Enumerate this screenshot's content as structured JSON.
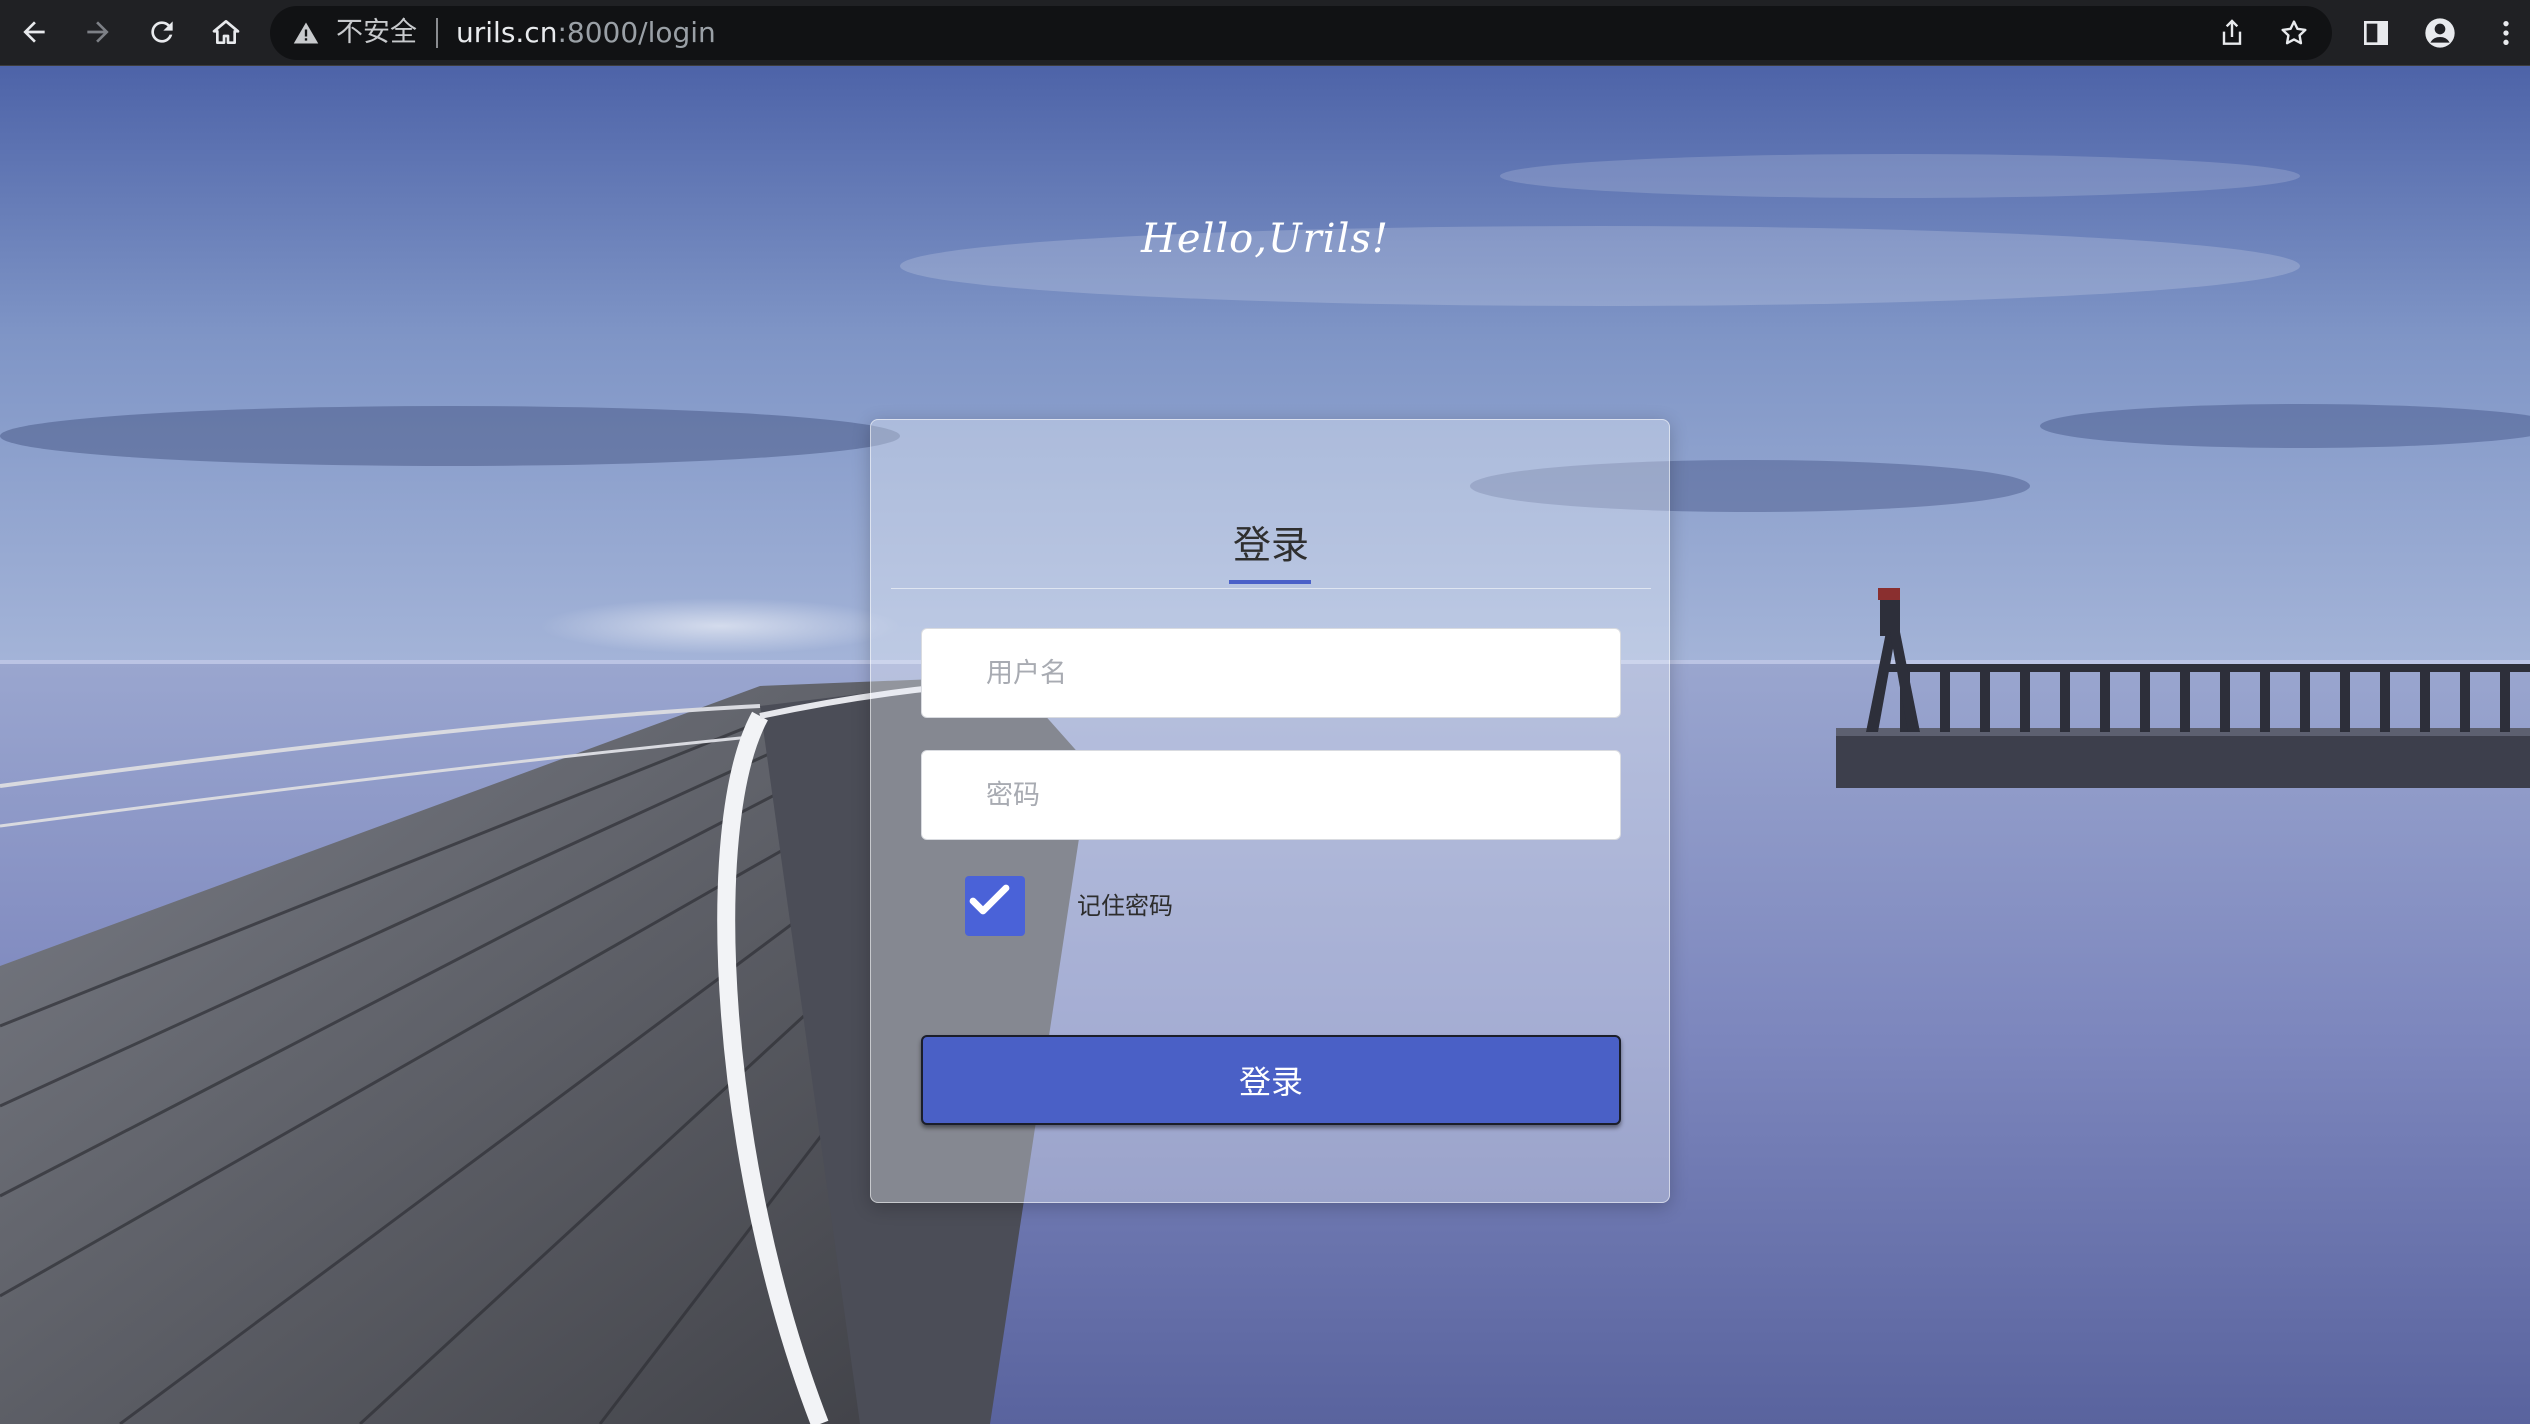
{
  "browser": {
    "security_label": "不安全",
    "url_host": "urils.cn",
    "url_path": ":8000/login"
  },
  "page": {
    "greeting": "Hello,Urils!"
  },
  "login": {
    "title": "登录",
    "username_placeholder": "用户名",
    "password_placeholder": "密码",
    "remember_label": "记住密码",
    "remember_checked": true,
    "submit_label": "登录",
    "accent_color": "#4a60c8"
  },
  "icons": [
    "back-icon",
    "forward-icon",
    "reload-icon",
    "home-icon",
    "warning-icon",
    "share-icon",
    "star-icon",
    "side-panel-icon",
    "profile-icon",
    "menu-icon",
    "checkmark-icon"
  ]
}
